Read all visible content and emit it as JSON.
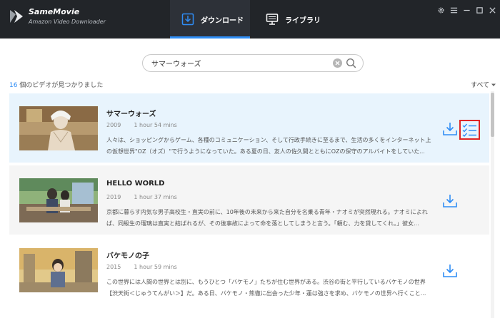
{
  "app": {
    "name": "SameMovie",
    "subtitle": "Amazon Video Downloader"
  },
  "tabs": [
    {
      "label": "ダウンロード",
      "active": true
    },
    {
      "label": "ライブラリ",
      "active": false
    }
  ],
  "search": {
    "value": "サマーウォーズ"
  },
  "results": {
    "count": "16",
    "text": " 個のビデオが見つかりました"
  },
  "filter": {
    "label": "すべて"
  },
  "videos": [
    {
      "title": "サマーウォーズ",
      "year": "2009",
      "duration": "1 hour 54 mins",
      "description": "人々は、ショッピングからゲーム、各種のコミュニケーション、そして行政手続きに至るまで、生活の多くをインターネット上の仮想世界\"OZ（オズ）\"で行うようになっていた。ある夏の日、友人の佐久間とともにOZの保守のアルバイトをしていた...",
      "selected": true
    },
    {
      "title": "HELLO WORLD",
      "year": "2019",
      "duration": "1 hour 37 mins",
      "description": "京都に暮らす内気な男子高校生・直実の前に、10年後の未来から来た自分を名乗る青年・ナオミが突然現れる。ナオミによれば、同級生の瑠璃は直実と結ばれるが、その後事故によって命を落としてしまうと言う。「頼む、力を貸してくれ。」彼女...",
      "selected": false
    },
    {
      "title": "バケモノの子",
      "year": "2015",
      "duration": "1 hour 59 mins",
      "description": "この世界には人間の世界とは別に、もうひとつ「バケモノ」たちが住む世界がある。渋谷の街と平行しているバケモノの世界【渋天街＜じゅうてんがい＞】だ。ある日、バケモノ・熊徹に出会った少年・蓮は強さを求め、バケモノの世界へ行くこと...",
      "selected": false
    }
  ],
  "colors": {
    "titlebar": "#222529",
    "accent": "#2f8df5",
    "highlight_border": "#e02525",
    "selected_row": "#e8f4fd"
  },
  "icons": {
    "logo": "samemovie-logo-icon",
    "download_tab": "download-tray-icon",
    "library_tab": "monitor-icon",
    "settings": "gear-icon",
    "menu": "hamburger-icon",
    "minimize": "minimize-icon",
    "maximize": "maximize-icon",
    "close": "close-icon",
    "search": "search-icon",
    "clear": "clear-icon",
    "download": "download-icon",
    "advanced": "checklist-icon"
  }
}
